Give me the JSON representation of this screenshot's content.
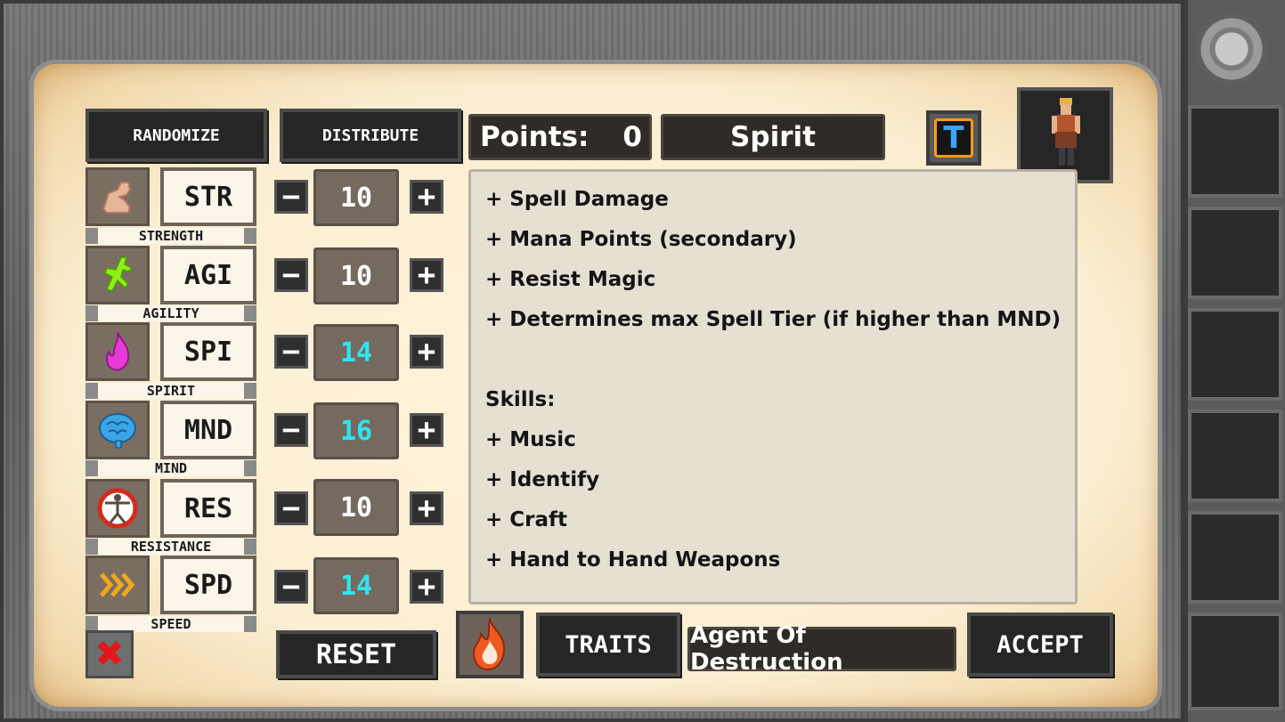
{
  "buttons": {
    "randomize": "RANDOMIZE",
    "distribute": "DISTRIBUTE",
    "reset": "RESET",
    "traits": "TRAITS",
    "accept": "ACCEPT",
    "minus": "−",
    "plus": "+",
    "close_glyph": "✖",
    "toggle_glyph": "T"
  },
  "points": {
    "label": "Points:",
    "value": "0"
  },
  "selected_attribute": "Spirit",
  "background_name": "Agent Of Destruction",
  "stats": [
    {
      "abbr": "STR",
      "name": "STRENGTH",
      "value": "10",
      "value_color": "#ffffff",
      "icon": "flexed-arm-icon"
    },
    {
      "abbr": "AGI",
      "name": "AGILITY",
      "value": "10",
      "value_color": "#ffffff",
      "icon": "running-figure-icon"
    },
    {
      "abbr": "SPI",
      "name": "SPIRIT",
      "value": "14",
      "value_color": "#2ee6f2",
      "icon": "spirit-flame-icon"
    },
    {
      "abbr": "MND",
      "name": "MIND",
      "value": "16",
      "value_color": "#2ee6f2",
      "icon": "brain-icon"
    },
    {
      "abbr": "RES",
      "name": "RESISTANCE",
      "value": "10",
      "value_color": "#ffffff",
      "icon": "vitruvian-man-icon"
    },
    {
      "abbr": "SPD",
      "name": "SPEED",
      "value": "14",
      "value_color": "#2ee6f2",
      "icon": "speed-chevrons-icon"
    }
  ],
  "description": {
    "lines": [
      "+ Spell Damage",
      "+ Mana Points (secondary)",
      "+ Resist Magic",
      "+ Determines max Spell Tier (if higher than MND)",
      "",
      "Skills:",
      "+ Music",
      "+ Identify",
      "+ Craft",
      "+ Hand to Hand Weapons"
    ]
  },
  "colors": {
    "boosted_value": "#2ee6f2",
    "normal_value": "#ffffff",
    "toggle_accent": "#ff9a1a",
    "toggle_letter": "#37a6ff",
    "close_red": "#e01818"
  }
}
